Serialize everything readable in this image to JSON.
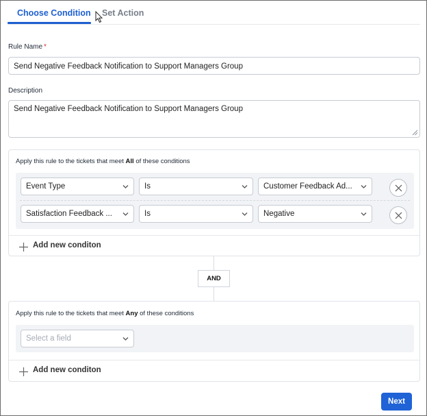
{
  "tabs": [
    {
      "label": "Choose Condition",
      "active": true
    },
    {
      "label": "Set Action",
      "active": false
    }
  ],
  "rule_name": {
    "label": "Rule Name",
    "required_marker": "*",
    "value": "Send Negative Feedback Notification to Support Managers Group"
  },
  "description": {
    "label": "Description",
    "value": "Send Negative Feedback Notification to Support Managers Group"
  },
  "all_conditions": {
    "title_prefix": "Apply this rule to the tickets that meet",
    "title_keyword": "All",
    "title_suffix": "of these conditions",
    "rows": [
      {
        "field": "Event Type",
        "operator": "Is",
        "value": "Customer Feedback Ad..."
      },
      {
        "field": "Satisfaction Feedback ...",
        "operator": "Is",
        "value": "Negative"
      }
    ],
    "add_label": "Add new conditon"
  },
  "connector": {
    "label": "AND"
  },
  "any_conditions": {
    "title_prefix": "Apply this rule to the tickets that meet",
    "title_keyword": "Any",
    "title_suffix": "of these conditions",
    "field_placeholder": "Select a field",
    "add_label": "Add new conditon"
  },
  "footer": {
    "next_label": "Next"
  },
  "colors": {
    "accent": "#1d5fd0",
    "primary_button": "#1f63d6",
    "required": "#d32f2f"
  },
  "icons": [
    "mouse-cursor-icon",
    "chevron-down-icon",
    "close-icon",
    "plus-icon",
    "resize-grip-icon"
  ]
}
